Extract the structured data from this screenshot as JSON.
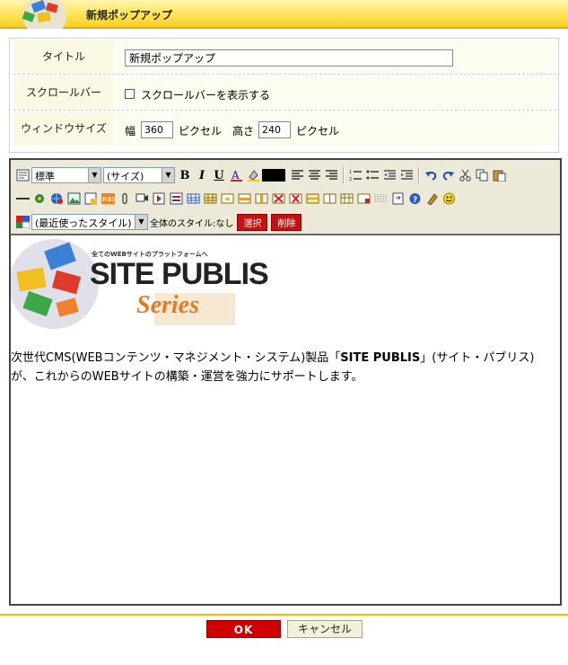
{
  "header": {
    "title": "新規ポップアップ"
  },
  "form": {
    "title_label": "タイトル",
    "title_value": "新規ポップアップ",
    "scrollbar_label": "スクロールバー",
    "scrollbar_checkbox_label": "スクロールバーを表示する",
    "scrollbar_checked": false,
    "window_size_label": "ウィンドウサイズ",
    "width_label": "幅",
    "width_value": "360",
    "height_label": "高さ",
    "height_value": "240",
    "unit_label": "ピクセル"
  },
  "toolbar": {
    "format_select": "標準",
    "size_select": "(サイズ)",
    "bold": "B",
    "italic": "I",
    "underline": "U",
    "style_select": "(最近使ったスタイル)",
    "all_style_text": "全体のスタイル:なし",
    "select_button": "選択",
    "delete_button": "削除"
  },
  "content": {
    "logo_tagline": "全てのWEBサイトのプラットフォームへ",
    "logo_title": "SITE PUBLIS",
    "logo_series": "Series",
    "text_before": "次世代CMS(WEBコンテンツ・マネジメント・システム)製品「",
    "text_brand": "SITE PUBLIS",
    "text_after": "」(サイト・パブリス)が、これからのWEBサイトの構築・運営を強力にサポートします。"
  },
  "footer": {
    "ok_label": "OK",
    "cancel_label": "キャンセル"
  },
  "colors": {
    "header_yellow": "#ffe14d",
    "ok_red": "#d00000",
    "label_bg": "#fbf9e4",
    "brand_orange": "#e87a1e"
  }
}
